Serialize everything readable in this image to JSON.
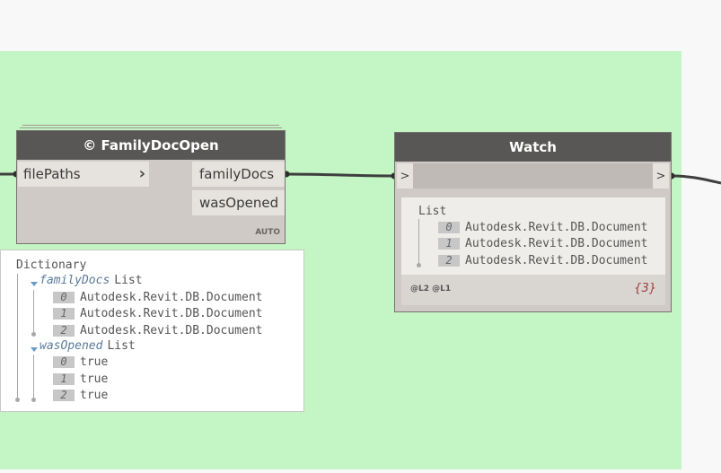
{
  "family_node": {
    "title": "© FamilyDocOpen",
    "input_port": "filePaths",
    "outputs": [
      "familyDocs",
      "wasOpened"
    ],
    "lacing": "AUTO"
  },
  "watch_node": {
    "title": "Watch",
    "in_symbol": ">",
    "out_symbol": ">",
    "list_label": "List",
    "items": [
      {
        "index": "0",
        "value": "Autodesk.Revit.DB.Document"
      },
      {
        "index": "1",
        "value": "Autodesk.Revit.DB.Document"
      },
      {
        "index": "2",
        "value": "Autodesk.Revit.DB.Document"
      }
    ],
    "levels": "@L2 @L1",
    "count": "{3}"
  },
  "preview": {
    "root": "Dictionary",
    "groups": [
      {
        "key": "familyDocs",
        "type": "List",
        "items": [
          {
            "index": "0",
            "value": "Autodesk.Revit.DB.Document"
          },
          {
            "index": "1",
            "value": "Autodesk.Revit.DB.Document"
          },
          {
            "index": "2",
            "value": "Autodesk.Revit.DB.Document"
          }
        ]
      },
      {
        "key": "wasOpened",
        "type": "List",
        "items": [
          {
            "index": "0",
            "value": "true"
          },
          {
            "index": "1",
            "value": "true"
          },
          {
            "index": "2",
            "value": "true"
          }
        ]
      }
    ]
  },
  "colors": {
    "group_background": "#c4f5c4",
    "node_header": "#595756",
    "node_body": "#cfcac5",
    "count_text": "#a13b3b"
  }
}
